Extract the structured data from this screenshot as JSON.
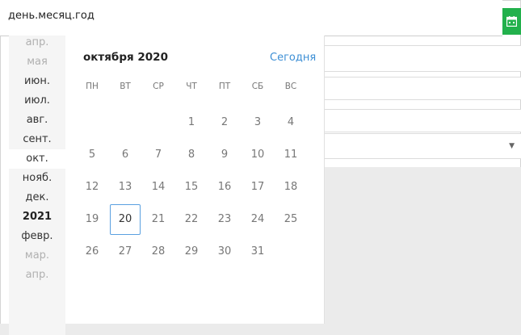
{
  "date_input": {
    "placeholder": "день.месяц.год",
    "button_icon": "calendar-icon",
    "button_color": "#22b14c"
  },
  "month_list": [
    {
      "label": "апр.",
      "state": "faded"
    },
    {
      "label": "мая",
      "state": "faded"
    },
    {
      "label": "июн.",
      "state": "normal"
    },
    {
      "label": "июл.",
      "state": "normal"
    },
    {
      "label": "авг.",
      "state": "normal"
    },
    {
      "label": "сент.",
      "state": "normal"
    },
    {
      "label": "окт.",
      "state": "selected"
    },
    {
      "label": "нояб.",
      "state": "normal"
    },
    {
      "label": "дек.",
      "state": "normal"
    },
    {
      "label": "2021",
      "state": "year"
    },
    {
      "label": "февр.",
      "state": "normal"
    },
    {
      "label": "мар.",
      "state": "faded"
    },
    {
      "label": "апр.",
      "state": "faded"
    }
  ],
  "calendar": {
    "title": "октября 2020",
    "today_label": "Сегодня",
    "weekdays": [
      "ПН",
      "ВТ",
      "СР",
      "ЧТ",
      "ПТ",
      "СБ",
      "ВС"
    ],
    "weeks": [
      [
        "",
        "",
        "",
        "1",
        "2",
        "3",
        "4"
      ],
      [
        "5",
        "6",
        "7",
        "8",
        "9",
        "10",
        "11"
      ],
      [
        "12",
        "13",
        "14",
        "15",
        "16",
        "17",
        "18"
      ],
      [
        "19",
        "20",
        "21",
        "22",
        "23",
        "24",
        "25"
      ],
      [
        "26",
        "27",
        "28",
        "29",
        "30",
        "31",
        ""
      ]
    ],
    "selected_day": "20",
    "accent_color": "#3d8fd5"
  }
}
